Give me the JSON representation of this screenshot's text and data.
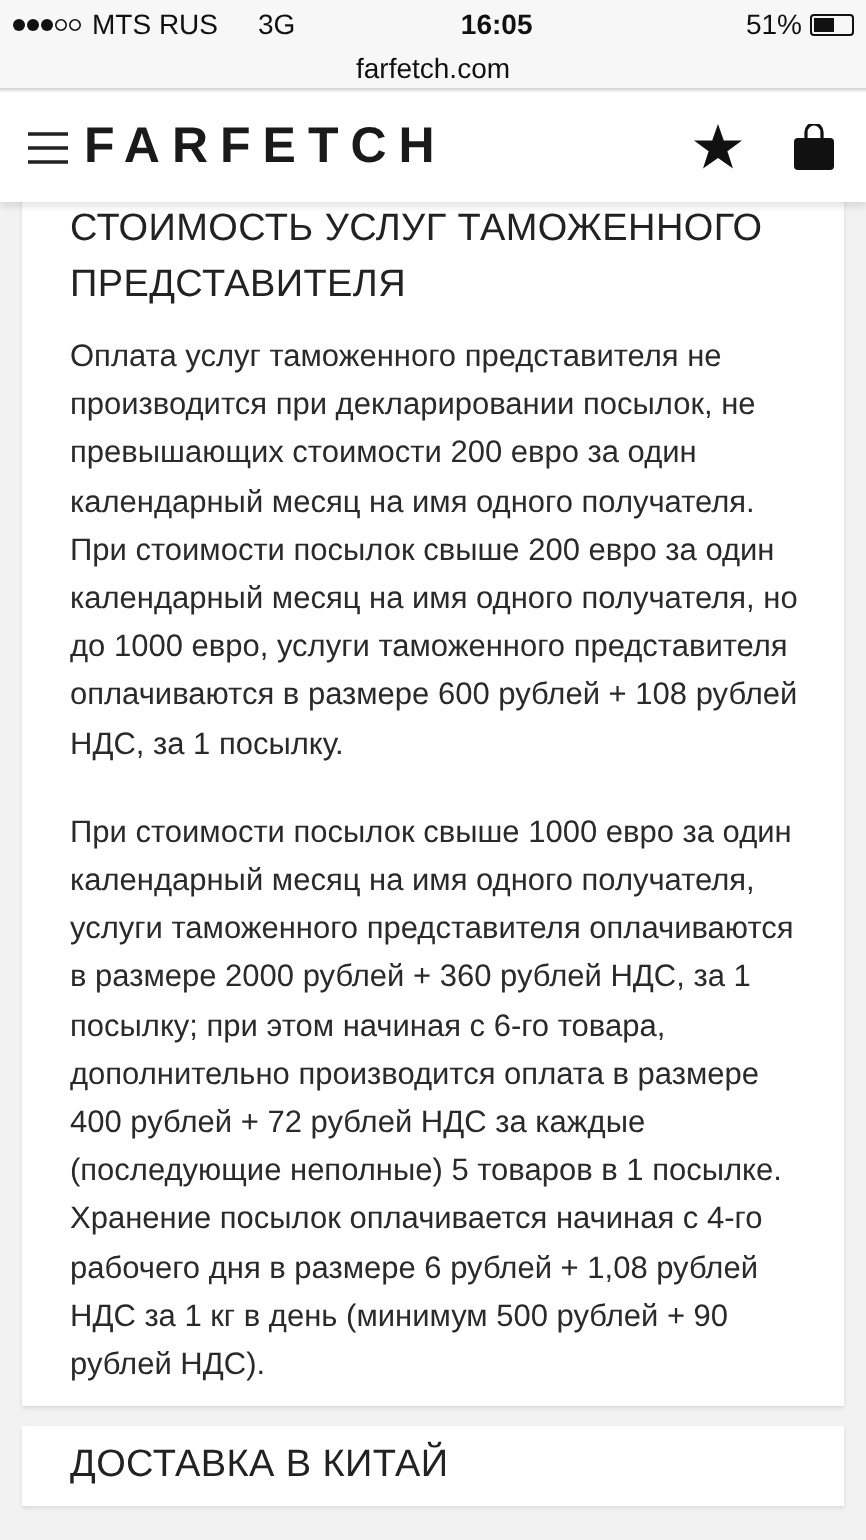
{
  "status_bar": {
    "carrier": "MTS RUS",
    "network": "3G",
    "time": "16:05",
    "battery": "51%"
  },
  "address_bar": {
    "url": "farfetch.com"
  },
  "header": {
    "logo": "FARFETCH"
  },
  "sections": [
    {
      "title": "СТОИМОСТЬ УСЛУГ ТАМОЖЕННОГО ПРЕДСТАВИТЕЛЯ",
      "paragraphs": [
        "Оплата услуг таможенного представителя не производится при декларировании посылок, не превышающих стоимости 200 евро за один календарный месяц на имя одного получателя. При стоимости посылок свыше 200 евро за один календарный месяц на имя одного получателя, но до 1000 евро, услуги таможенного представителя оплачиваются в размере 600 рублей + 108 рублей НДС, за 1 посылку.",
        "При стоимости посылок свыше 1000 евро за один календарный месяц на имя одного получателя, услуги таможенного представителя оплачиваются в размере 2000 рублей + 360 рублей НДС, за 1 посылку; при этом начиная с 6-го товара, дополнительно производится оплата в размере 400 рублей + 72 рублей НДС за каждые (последующие неполные) 5 товаров в 1 посылке. Хранение посылок оплачивается начиная с 4-го рабочего дня в размере 6 рублей + 1,08 рублей НДС за 1 кг в день (минимум 500 рублей + 90 рублей НДС)."
      ]
    },
    {
      "title": "ДОСТАВКА В КИТАЙ"
    }
  ]
}
